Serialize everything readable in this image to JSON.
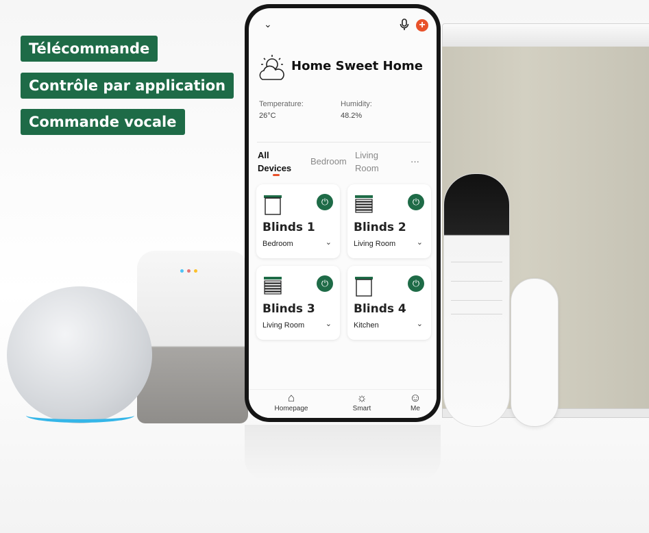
{
  "features": [
    "Télécommande",
    "Contrôle par application",
    "Commande vocale"
  ],
  "app": {
    "home_name": "Home Sweet Home",
    "temperature_label": "Temperature:",
    "temperature_value": "26°C",
    "humidity_label": "Humidity:",
    "humidity_value": "48.2%",
    "tabs": [
      {
        "label": "All\nDevices",
        "active": true
      },
      {
        "label": "Bedroom",
        "active": false
      },
      {
        "label": "Living\nRoom",
        "active": false
      }
    ],
    "more": "···",
    "devices": [
      {
        "name": "Blinds 1",
        "room": "Bedroom",
        "icon": "roller-blind-icon"
      },
      {
        "name": "Blinds 2",
        "room": "Living Room",
        "icon": "venetian-blind-icon"
      },
      {
        "name": "Blinds 3",
        "room": "Living Room",
        "icon": "venetian-blind-icon"
      },
      {
        "name": "Blinds 4",
        "room": "Kitchen",
        "icon": "roller-blind-icon"
      }
    ],
    "nav": [
      {
        "label": "Homepage",
        "icon": "house-icon"
      },
      {
        "label": "Smart",
        "icon": "sun-icon"
      },
      {
        "label": "Me",
        "icon": "user-icon"
      }
    ]
  },
  "colors": {
    "brand_green": "#1e6b47",
    "accent_orange": "#e8522b"
  }
}
